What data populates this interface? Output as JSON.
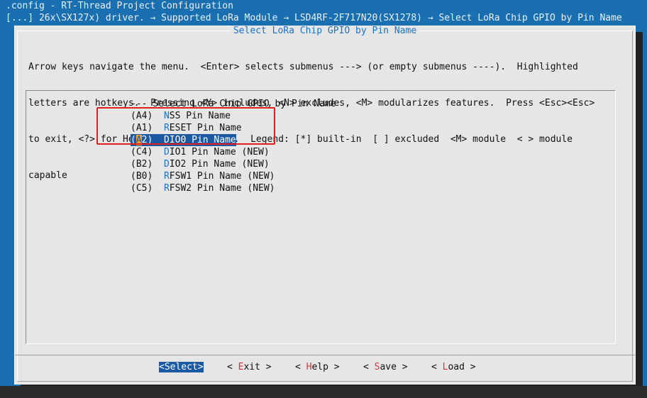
{
  "terminal": {
    "title_line": ".config - RT-Thread Project Configuration",
    "breadcrumb": "[...] 26x\\SX127x) driver. → Supported LoRa Module → LSD4RF-2F717N20(SX1278) → Select LoRa Chip GPIO by Pin Name"
  },
  "dialog": {
    "title": "Select LoRa Chip GPIO by Pin Name",
    "help_lines": [
      "Arrow keys navigate the menu.  <Enter> selects submenus ---> (or empty submenus ----).  Highlighted",
      "letters are hotkeys.  Pressing <Y> includes, <N> excludes, <M> modularizes features.  Press <Esc><Esc>",
      "to exit, <?> for Help, </> for Search.  Legend: [*] built-in  [ ] excluded  <M> module  < > module",
      "capable"
    ],
    "list_header": "--- Select LoRa Chip GPIO by Pin Name",
    "items": [
      {
        "value": "A4",
        "hotkey": "N",
        "label_rest": "SS Pin Name",
        "suffix": ""
      },
      {
        "value": "A1",
        "hotkey": "R",
        "label_rest": "ESET Pin Name",
        "suffix": ""
      },
      {
        "value": "A2",
        "hotkey": "D",
        "label_rest": "IO0 Pin Name",
        "suffix": ""
      },
      {
        "value": "C4",
        "hotkey": "D",
        "label_rest": "IO1 Pin Name",
        "suffix": " (NEW)"
      },
      {
        "value": "B2",
        "hotkey": "D",
        "label_rest": "IO2 Pin Name",
        "suffix": " (NEW)"
      },
      {
        "value": "B0",
        "hotkey": "R",
        "label_rest": "FSW1 Pin Name",
        "suffix": " (NEW)"
      },
      {
        "value": "C5",
        "hotkey": "R",
        "label_rest": "FSW2 Pin Name",
        "suffix": " (NEW)"
      }
    ],
    "selected_index": 2,
    "buttons": [
      {
        "key": "select",
        "label": "Select",
        "hotkey_index": 0
      },
      {
        "key": "exit",
        "label": "Exit",
        "hotkey_index": 0
      },
      {
        "key": "help",
        "label": "Help",
        "hotkey_index": 0
      },
      {
        "key": "save",
        "label": "Save",
        "hotkey_index": 0
      },
      {
        "key": "load",
        "label": "Load",
        "hotkey_index": 0
      }
    ],
    "active_button": "select"
  },
  "colors": {
    "background": "#1a6fb0",
    "dialog": "#e6e6e6",
    "selection": "#1b5aa3",
    "hotkey": "#1a73c7",
    "button_hotkey": "#e03030",
    "annotation": "#e02020"
  }
}
